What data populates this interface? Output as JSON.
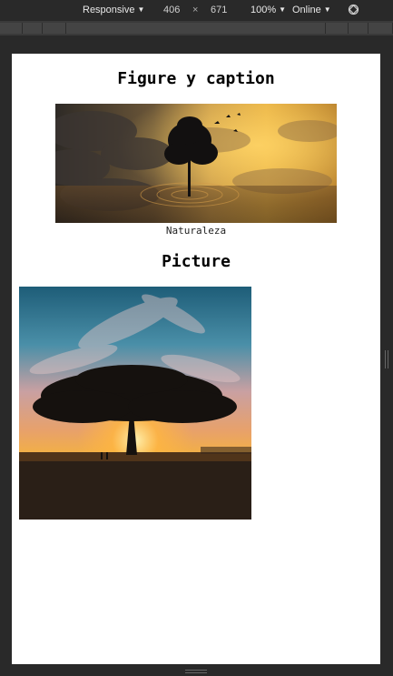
{
  "devtools": {
    "device_label": "Responsive",
    "width": "406",
    "times": "×",
    "height": "671",
    "zoom": "100%",
    "throttle": "Online",
    "rotate_icon": "rotate-icon"
  },
  "page": {
    "figure_heading": "Figure y caption",
    "figure_caption": "Naturaleza",
    "figure_image": "clouds-tree-sunset",
    "picture_heading": "Picture",
    "picture_image": "tree-sunset"
  }
}
